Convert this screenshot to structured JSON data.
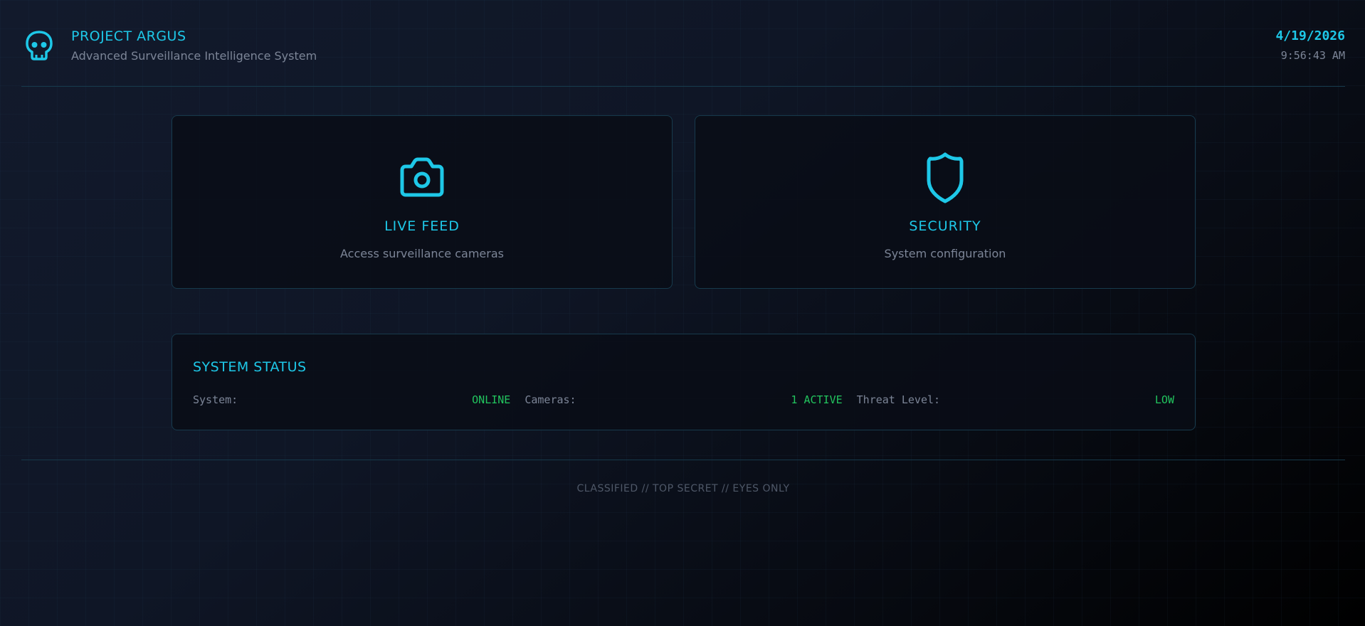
{
  "header": {
    "title": "PROJECT ARGUS",
    "subtitle": "Advanced Surveillance Intelligence System",
    "date": "4/19/2026",
    "time": "9:56:43 AM",
    "logo_icon": "skull-icon"
  },
  "cards": [
    {
      "icon": "camera-icon",
      "title": "LIVE FEED",
      "description": "Access surveillance cameras"
    },
    {
      "icon": "shield-icon",
      "title": "SECURITY",
      "description": "System configuration"
    }
  ],
  "system_status": {
    "title": "SYSTEM STATUS",
    "items": [
      {
        "label": "System:",
        "value": "ONLINE"
      },
      {
        "label": "Cameras:",
        "value": "1 ACTIVE"
      },
      {
        "label": "Threat Level:",
        "value": "LOW"
      }
    ]
  },
  "footer": {
    "text": "CLASSIFIED // TOP SECRET // EYES ONLY"
  },
  "colors": {
    "accent": "#1ec8e8",
    "status_ok": "#22c55e",
    "muted_text": "#7c8597",
    "border": "#173a4c"
  }
}
